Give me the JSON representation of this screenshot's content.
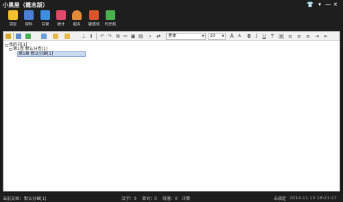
{
  "app": {
    "title": "小黑屋（概念版）"
  },
  "window_controls": {
    "skin": "👕",
    "menu": "▾",
    "minimize": "—",
    "maximize": "□",
    "close": "✕"
  },
  "ribbon": [
    {
      "label": "锁定",
      "icon": "lock-icon",
      "color": "#f2c12e"
    },
    {
      "label": "资料",
      "icon": "document-icon",
      "color": "#4b7fd6"
    },
    {
      "label": "目录",
      "icon": "catalog-icon",
      "color": "#3d8ee0"
    },
    {
      "label": "统计",
      "icon": "statistics-icon",
      "color": "#e04a6a"
    },
    {
      "label": "起名",
      "icon": "person-icon",
      "color": "#e08a3a"
    },
    {
      "label": "敏感词",
      "icon": "sensitive-word-icon",
      "color": "#d9532b"
    },
    {
      "label": "时光机",
      "icon": "time-machine-icon",
      "color": "#4caf50"
    }
  ],
  "toolbar": {
    "font_name": "黑体",
    "font_size": "20",
    "bold": "B",
    "italic": "I",
    "underline": "U",
    "strike": "T",
    "grow": "A",
    "shrink": "A"
  },
  "tree": {
    "root": "我的书[1]",
    "volume": "第1卷 默认分卷[1]",
    "chapter": "第1章 默认分章[1]"
  },
  "status": {
    "current_doc_label": "当前文档：",
    "current_doc": "默认分章[1]",
    "chars": "汉字：0",
    "words": "单词：0",
    "paragraphs": "段落：0",
    "detail": "详情",
    "lock_state": "未锁定",
    "datetime": "2014-11-10 18:21:27"
  },
  "colors": {
    "background": "#1a1a1a",
    "editor": "#ffffff",
    "selection": "#c9d9f2"
  }
}
